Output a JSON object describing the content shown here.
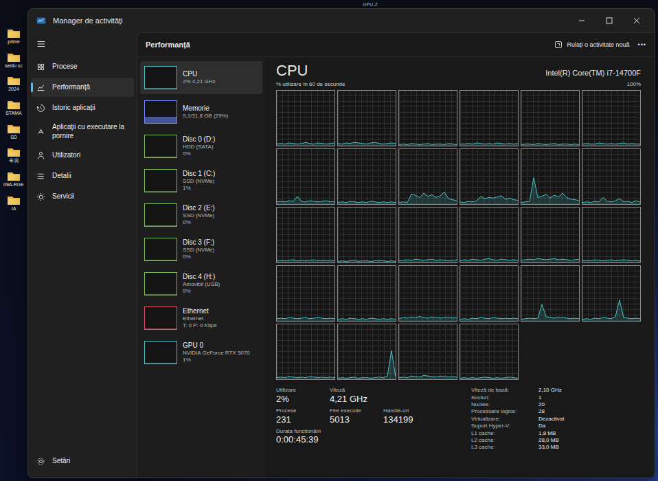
{
  "desktop": {
    "top_labels": [
      "GPU-Z"
    ],
    "icons": [
      {
        "label": "prime"
      },
      {
        "label": "sediu sc"
      },
      {
        "label": "2024"
      },
      {
        "label": "STAMA"
      },
      {
        "label": "SD"
      },
      {
        "label": "丰润"
      },
      {
        "label": "09A-RGE"
      },
      {
        "label": "IA"
      }
    ]
  },
  "window": {
    "title": "Manager de activități"
  },
  "nav": {
    "items": [
      {
        "label": "Procese",
        "selected": false
      },
      {
        "label": "Performanță",
        "selected": true
      },
      {
        "label": "Istoric aplicații",
        "selected": false
      },
      {
        "label": "Aplicații cu executare la pornire",
        "selected": false
      },
      {
        "label": "Utilizatori",
        "selected": false
      },
      {
        "label": "Detalii",
        "selected": false
      },
      {
        "label": "Servicii",
        "selected": false
      }
    ],
    "settings": "Setări"
  },
  "header": {
    "title": "Performanță",
    "run_task": "Rulați o activitate nouă",
    "more": "•••"
  },
  "devices": [
    {
      "name": "CPU",
      "lines": [
        "2% 4,21 GHz"
      ],
      "selected": true,
      "level": 0.02,
      "color": "#4cc2c4"
    },
    {
      "name": "Memorie",
      "lines": [
        "9,1/31,8 GB (29%)"
      ],
      "selected": false,
      "level": 0.29,
      "color": "#6b8cff"
    },
    {
      "name": "Disc 0 (D:)",
      "lines": [
        "HDD (SATA)",
        "0%"
      ],
      "selected": false,
      "level": 0,
      "color": "#7fbf5a"
    },
    {
      "name": "Disc 1 (C:)",
      "lines": [
        "SSD (NVMe)",
        "1%"
      ],
      "selected": false,
      "level": 0.01,
      "color": "#7fbf5a"
    },
    {
      "name": "Disc 2 (E:)",
      "lines": [
        "SSD (NVMe)",
        "0%"
      ],
      "selected": false,
      "level": 0,
      "color": "#7fbf5a"
    },
    {
      "name": "Disc 3 (F:)",
      "lines": [
        "SSD (NVMe)",
        "0%"
      ],
      "selected": false,
      "level": 0,
      "color": "#7fbf5a"
    },
    {
      "name": "Disc 4 (H:)",
      "lines": [
        "Amovibil (USB)",
        "0%"
      ],
      "selected": false,
      "level": 0,
      "color": "#7fbf5a"
    },
    {
      "name": "Ethernet",
      "lines": [
        "Ethernet",
        "T: 0 P: 0 Kbps"
      ],
      "selected": false,
      "level": 0,
      "color": "#e0556a"
    },
    {
      "name": "GPU 0",
      "lines": [
        "NVIDIA GeForce RTX 5070",
        "1%"
      ],
      "selected": false,
      "level": 0.01,
      "color": "#4cc2c4"
    }
  ],
  "cpu": {
    "title": "CPU",
    "model": "Intel(R) Core(TM) i7-14700F"
  },
  "chart": {
    "title": "% utilizare în 60 de secunde",
    "max_label": "100%",
    "series": [
      {
        "values": [
          3,
          4,
          3,
          5,
          4,
          3,
          4,
          6,
          4,
          3,
          5,
          4,
          3,
          4,
          5
        ]
      },
      {
        "values": [
          4,
          3,
          5,
          4,
          6,
          5,
          4,
          3,
          5,
          6,
          4,
          3,
          4,
          5,
          4
        ]
      },
      {
        "values": [
          2,
          3,
          2,
          4,
          3,
          2,
          3,
          4,
          2,
          3,
          3,
          2,
          4,
          3,
          2
        ]
      },
      {
        "values": [
          3,
          3,
          4,
          3,
          5,
          4,
          3,
          4,
          3,
          5,
          4,
          3,
          4,
          3,
          4
        ]
      },
      {
        "values": [
          2,
          3,
          3,
          2,
          4,
          3,
          2,
          3,
          4,
          2,
          3,
          3,
          2,
          3,
          2
        ]
      },
      {
        "values": [
          3,
          4,
          3,
          3,
          5,
          4,
          3,
          4,
          3,
          4,
          5,
          3,
          4,
          3,
          3
        ]
      },
      {
        "values": [
          4,
          5,
          4,
          6,
          5,
          14,
          5,
          4,
          6,
          5,
          4,
          5,
          6,
          4,
          5
        ]
      },
      {
        "values": [
          3,
          4,
          3,
          5,
          4,
          3,
          4,
          3,
          5,
          4,
          3,
          4,
          3,
          4,
          3
        ]
      },
      {
        "values": [
          3,
          4,
          3,
          18,
          16,
          12,
          20,
          14,
          17,
          12,
          15,
          22,
          10,
          8,
          6
        ]
      },
      {
        "values": [
          4,
          3,
          5,
          4,
          6,
          14,
          10,
          12,
          11,
          13,
          15,
          9,
          11,
          8,
          7
        ]
      },
      {
        "values": [
          3,
          4,
          5,
          48,
          12,
          14,
          18,
          11,
          16,
          13,
          20,
          12,
          9,
          8,
          6
        ]
      },
      {
        "values": [
          3,
          4,
          3,
          5,
          4,
          12,
          5,
          4,
          6,
          10,
          4,
          5,
          3,
          6,
          4
        ]
      },
      {
        "values": [
          3,
          4,
          3,
          4,
          5,
          3,
          4,
          3,
          4,
          5,
          3,
          4,
          3,
          4,
          3
        ]
      },
      {
        "values": [
          2,
          3,
          2,
          3,
          4,
          2,
          3,
          3,
          2,
          3,
          4,
          3,
          2,
          3,
          2
        ]
      },
      {
        "values": [
          3,
          4,
          5,
          4,
          6,
          5,
          4,
          5,
          6,
          4,
          5,
          4,
          3,
          4,
          5
        ]
      },
      {
        "values": [
          3,
          5,
          4,
          6,
          5,
          4,
          6,
          7,
          5,
          4,
          6,
          5,
          4,
          5,
          4
        ]
      },
      {
        "values": [
          4,
          5,
          6,
          5,
          7,
          6,
          5,
          6,
          7,
          5,
          6,
          5,
          4,
          5,
          6
        ]
      },
      {
        "values": [
          3,
          4,
          3,
          5,
          4,
          3,
          4,
          5,
          3,
          4,
          5,
          4,
          3,
          4,
          3
        ]
      },
      {
        "values": [
          4,
          5,
          4,
          6,
          5,
          4,
          5,
          6,
          4,
          5,
          6,
          5,
          4,
          5,
          4
        ]
      },
      {
        "values": [
          3,
          4,
          3,
          5,
          4,
          3,
          4,
          3,
          5,
          4,
          3,
          4,
          3,
          4,
          3
        ]
      },
      {
        "values": [
          4,
          6,
          5,
          7,
          6,
          8,
          6,
          5,
          7,
          6,
          5,
          6,
          7,
          5,
          6
        ]
      },
      {
        "values": [
          3,
          4,
          3,
          5,
          4,
          6,
          5,
          4,
          6,
          5,
          4,
          5,
          4,
          5,
          4
        ]
      },
      {
        "values": [
          3,
          4,
          5,
          4,
          5,
          30,
          8,
          6,
          5,
          7,
          6,
          5,
          4,
          5,
          4
        ]
      },
      {
        "values": [
          3,
          4,
          3,
          5,
          4,
          6,
          5,
          4,
          8,
          38,
          6,
          5,
          4,
          5,
          4
        ]
      },
      {
        "values": [
          3,
          4,
          3,
          5,
          4,
          3,
          4,
          3,
          5,
          4,
          3,
          4,
          3,
          4,
          3
        ]
      },
      {
        "values": [
          2,
          3,
          2,
          3,
          4,
          2,
          3,
          3,
          2,
          3,
          4,
          3,
          6,
          52,
          5
        ]
      },
      {
        "values": [
          3,
          4,
          3,
          6,
          5,
          4,
          7,
          6,
          5,
          4,
          6,
          5,
          4,
          5,
          4
        ]
      },
      {
        "values": [
          2,
          3,
          2,
          3,
          2,
          3,
          4,
          3,
          2,
          3,
          2,
          3,
          4,
          3,
          2
        ]
      }
    ]
  },
  "stat_rows": [
    [
      {
        "label": "Utilizare",
        "value": "2%"
      },
      {
        "label": "Viteză",
        "value": "4,21 GHz"
      }
    ],
    [
      {
        "label": "Procese",
        "value": "231"
      },
      {
        "label": "Fire execuție",
        "value": "5013"
      },
      {
        "label": "Handle-uri",
        "value": "134199"
      }
    ],
    [
      {
        "label": "Durata funcționării",
        "value": "0:00:45:39"
      }
    ]
  ],
  "specs": [
    {
      "label": "Viteză de bază:",
      "value": "2,10 GHz"
    },
    {
      "label": "Socluri:",
      "value": "1"
    },
    {
      "label": "Nuclee:",
      "value": "20"
    },
    {
      "label": "Procesoare logice:",
      "value": "28"
    },
    {
      "label": "Virtualizare:",
      "value": "Dezactivat"
    },
    {
      "label": "Suport Hyper-V:",
      "value": "Da"
    },
    {
      "label": "L1 cache:",
      "value": "1,8 MB"
    },
    {
      "label": "L2 cache:",
      "value": "28,0 MB"
    },
    {
      "label": "L3 cache:",
      "value": "33,0 MB"
    }
  ]
}
